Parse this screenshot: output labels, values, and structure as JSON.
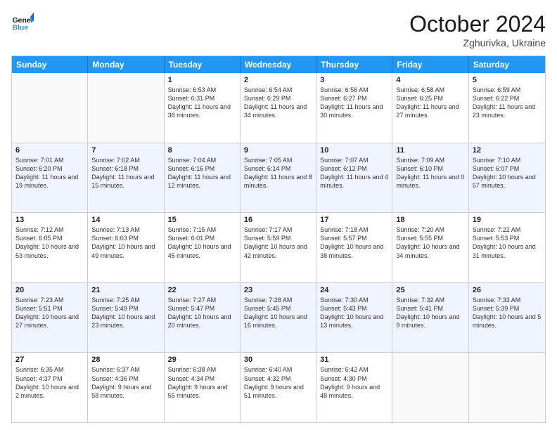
{
  "header": {
    "logo_general": "General",
    "logo_blue": "Blue",
    "month_title": "October 2024",
    "location": "Zghurivka, Ukraine"
  },
  "days_of_week": [
    "Sunday",
    "Monday",
    "Tuesday",
    "Wednesday",
    "Thursday",
    "Friday",
    "Saturday"
  ],
  "rows": [
    [
      {
        "day": "",
        "sunrise": "",
        "sunset": "",
        "daylight": "",
        "empty": true
      },
      {
        "day": "",
        "sunrise": "",
        "sunset": "",
        "daylight": "",
        "empty": true
      },
      {
        "day": "1",
        "sunrise": "Sunrise: 6:53 AM",
        "sunset": "Sunset: 6:31 PM",
        "daylight": "Daylight: 11 hours and 38 minutes."
      },
      {
        "day": "2",
        "sunrise": "Sunrise: 6:54 AM",
        "sunset": "Sunset: 6:29 PM",
        "daylight": "Daylight: 11 hours and 34 minutes."
      },
      {
        "day": "3",
        "sunrise": "Sunrise: 6:56 AM",
        "sunset": "Sunset: 6:27 PM",
        "daylight": "Daylight: 11 hours and 30 minutes."
      },
      {
        "day": "4",
        "sunrise": "Sunrise: 6:58 AM",
        "sunset": "Sunset: 6:25 PM",
        "daylight": "Daylight: 11 hours and 27 minutes."
      },
      {
        "day": "5",
        "sunrise": "Sunrise: 6:59 AM",
        "sunset": "Sunset: 6:22 PM",
        "daylight": "Daylight: 11 hours and 23 minutes."
      }
    ],
    [
      {
        "day": "6",
        "sunrise": "Sunrise: 7:01 AM",
        "sunset": "Sunset: 6:20 PM",
        "daylight": "Daylight: 11 hours and 19 minutes."
      },
      {
        "day": "7",
        "sunrise": "Sunrise: 7:02 AM",
        "sunset": "Sunset: 6:18 PM",
        "daylight": "Daylight: 11 hours and 15 minutes."
      },
      {
        "day": "8",
        "sunrise": "Sunrise: 7:04 AM",
        "sunset": "Sunset: 6:16 PM",
        "daylight": "Daylight: 11 hours and 12 minutes."
      },
      {
        "day": "9",
        "sunrise": "Sunrise: 7:05 AM",
        "sunset": "Sunset: 6:14 PM",
        "daylight": "Daylight: 11 hours and 8 minutes."
      },
      {
        "day": "10",
        "sunrise": "Sunrise: 7:07 AM",
        "sunset": "Sunset: 6:12 PM",
        "daylight": "Daylight: 11 hours and 4 minutes."
      },
      {
        "day": "11",
        "sunrise": "Sunrise: 7:09 AM",
        "sunset": "Sunset: 6:10 PM",
        "daylight": "Daylight: 11 hours and 0 minutes."
      },
      {
        "day": "12",
        "sunrise": "Sunrise: 7:10 AM",
        "sunset": "Sunset: 6:07 PM",
        "daylight": "Daylight: 10 hours and 57 minutes."
      }
    ],
    [
      {
        "day": "13",
        "sunrise": "Sunrise: 7:12 AM",
        "sunset": "Sunset: 6:05 PM",
        "daylight": "Daylight: 10 hours and 53 minutes."
      },
      {
        "day": "14",
        "sunrise": "Sunrise: 7:13 AM",
        "sunset": "Sunset: 6:03 PM",
        "daylight": "Daylight: 10 hours and 49 minutes."
      },
      {
        "day": "15",
        "sunrise": "Sunrise: 7:15 AM",
        "sunset": "Sunset: 6:01 PM",
        "daylight": "Daylight: 10 hours and 45 minutes."
      },
      {
        "day": "16",
        "sunrise": "Sunrise: 7:17 AM",
        "sunset": "Sunset: 5:59 PM",
        "daylight": "Daylight: 10 hours and 42 minutes."
      },
      {
        "day": "17",
        "sunrise": "Sunrise: 7:18 AM",
        "sunset": "Sunset: 5:57 PM",
        "daylight": "Daylight: 10 hours and 38 minutes."
      },
      {
        "day": "18",
        "sunrise": "Sunrise: 7:20 AM",
        "sunset": "Sunset: 5:55 PM",
        "daylight": "Daylight: 10 hours and 34 minutes."
      },
      {
        "day": "19",
        "sunrise": "Sunrise: 7:22 AM",
        "sunset": "Sunset: 5:53 PM",
        "daylight": "Daylight: 10 hours and 31 minutes."
      }
    ],
    [
      {
        "day": "20",
        "sunrise": "Sunrise: 7:23 AM",
        "sunset": "Sunset: 5:51 PM",
        "daylight": "Daylight: 10 hours and 27 minutes."
      },
      {
        "day": "21",
        "sunrise": "Sunrise: 7:25 AM",
        "sunset": "Sunset: 5:49 PM",
        "daylight": "Daylight: 10 hours and 23 minutes."
      },
      {
        "day": "22",
        "sunrise": "Sunrise: 7:27 AM",
        "sunset": "Sunset: 5:47 PM",
        "daylight": "Daylight: 10 hours and 20 minutes."
      },
      {
        "day": "23",
        "sunrise": "Sunrise: 7:28 AM",
        "sunset": "Sunset: 5:45 PM",
        "daylight": "Daylight: 10 hours and 16 minutes."
      },
      {
        "day": "24",
        "sunrise": "Sunrise: 7:30 AM",
        "sunset": "Sunset: 5:43 PM",
        "daylight": "Daylight: 10 hours and 13 minutes."
      },
      {
        "day": "25",
        "sunrise": "Sunrise: 7:32 AM",
        "sunset": "Sunset: 5:41 PM",
        "daylight": "Daylight: 10 hours and 9 minutes."
      },
      {
        "day": "26",
        "sunrise": "Sunrise: 7:33 AM",
        "sunset": "Sunset: 5:39 PM",
        "daylight": "Daylight: 10 hours and 5 minutes."
      }
    ],
    [
      {
        "day": "27",
        "sunrise": "Sunrise: 6:35 AM",
        "sunset": "Sunset: 4:37 PM",
        "daylight": "Daylight: 10 hours and 2 minutes."
      },
      {
        "day": "28",
        "sunrise": "Sunrise: 6:37 AM",
        "sunset": "Sunset: 4:36 PM",
        "daylight": "Daylight: 9 hours and 58 minutes."
      },
      {
        "day": "29",
        "sunrise": "Sunrise: 6:38 AM",
        "sunset": "Sunset: 4:34 PM",
        "daylight": "Daylight: 9 hours and 55 minutes."
      },
      {
        "day": "30",
        "sunrise": "Sunrise: 6:40 AM",
        "sunset": "Sunset: 4:32 PM",
        "daylight": "Daylight: 9 hours and 51 minutes."
      },
      {
        "day": "31",
        "sunrise": "Sunrise: 6:42 AM",
        "sunset": "Sunset: 4:30 PM",
        "daylight": "Daylight: 9 hours and 48 minutes."
      },
      {
        "day": "",
        "sunrise": "",
        "sunset": "",
        "daylight": "",
        "empty": true
      },
      {
        "day": "",
        "sunrise": "",
        "sunset": "",
        "daylight": "",
        "empty": true
      }
    ]
  ]
}
